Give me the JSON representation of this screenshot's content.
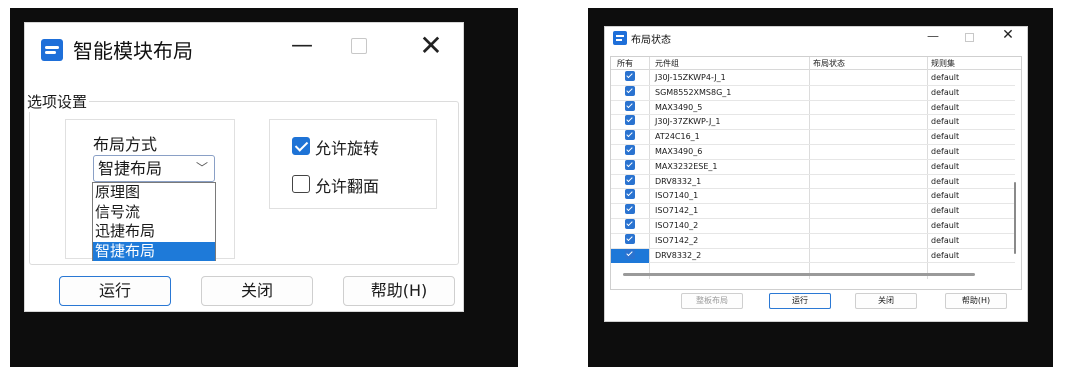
{
  "left_dialog": {
    "title": "智能模块布局",
    "icon": "app-layout-icon",
    "group_label": "选项设置",
    "layout_label": "布局方式",
    "combo_value": "智捷布局",
    "dropdown_options": [
      "原理图",
      "信号流",
      "迅捷布局",
      "智捷布局"
    ],
    "selected_option_index": 3,
    "checkbox_rotate": {
      "label": "允许旋转",
      "checked": true
    },
    "checkbox_flip": {
      "label": "允许翻面",
      "checked": false
    },
    "buttons": {
      "run": "运行",
      "close": "关闭",
      "help": "帮助(H)"
    }
  },
  "right_dialog": {
    "title": "布局状态",
    "columns": [
      "所有",
      "元件组",
      "布局状态",
      "规则集"
    ],
    "rows": [
      {
        "group": "J30J-15ZKWP4-J_1",
        "status": "",
        "rule": "default",
        "checked": true
      },
      {
        "group": "SGM8552XMS8G_1",
        "status": "",
        "rule": "default",
        "checked": true
      },
      {
        "group": "MAX3490_5",
        "status": "",
        "rule": "default",
        "checked": true
      },
      {
        "group": "J30J-37ZKWP-J_1",
        "status": "",
        "rule": "default",
        "checked": true
      },
      {
        "group": "AT24C16_1",
        "status": "",
        "rule": "default",
        "checked": true
      },
      {
        "group": "MAX3490_6",
        "status": "",
        "rule": "default",
        "checked": true
      },
      {
        "group": "MAX3232ESE_1",
        "status": "",
        "rule": "default",
        "checked": true
      },
      {
        "group": "DRV8332_1",
        "status": "",
        "rule": "default",
        "checked": true
      },
      {
        "group": "ISO7140_1",
        "status": "",
        "rule": "default",
        "checked": true
      },
      {
        "group": "ISO7142_1",
        "status": "",
        "rule": "default",
        "checked": true
      },
      {
        "group": "ISO7140_2",
        "status": "",
        "rule": "default",
        "checked": true
      },
      {
        "group": "ISO7142_2",
        "status": "",
        "rule": "default",
        "checked": true
      },
      {
        "group": "DRV8332_2",
        "status": "",
        "rule": "default",
        "checked": true,
        "selected": true
      }
    ],
    "buttons": {
      "whole": "整板布局",
      "run": "运行",
      "close": "关闭",
      "help": "帮助(H)"
    }
  },
  "colors": {
    "accent": "#1e73d6",
    "selection": "#1e7ad9",
    "frame": "#0d0d0d"
  }
}
